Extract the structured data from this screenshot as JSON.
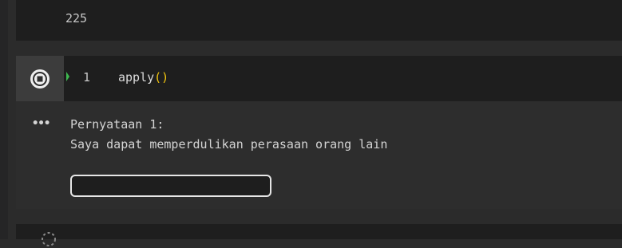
{
  "previous_cell": {
    "output_value": "225"
  },
  "cell": {
    "run_button_icon": "stop-icon",
    "execution_indicator_color": "#3fb950",
    "line_number": "1",
    "code": {
      "function_name": "apply",
      "parens": "()"
    },
    "output": {
      "more_icon": "•••",
      "lines": [
        "Pernyataan 1:",
        "Saya dapat memperdulikan perasaan orang lain"
      ],
      "input_value": ""
    }
  },
  "next_cell": {
    "run_button_icon": "spinner-icon"
  }
}
